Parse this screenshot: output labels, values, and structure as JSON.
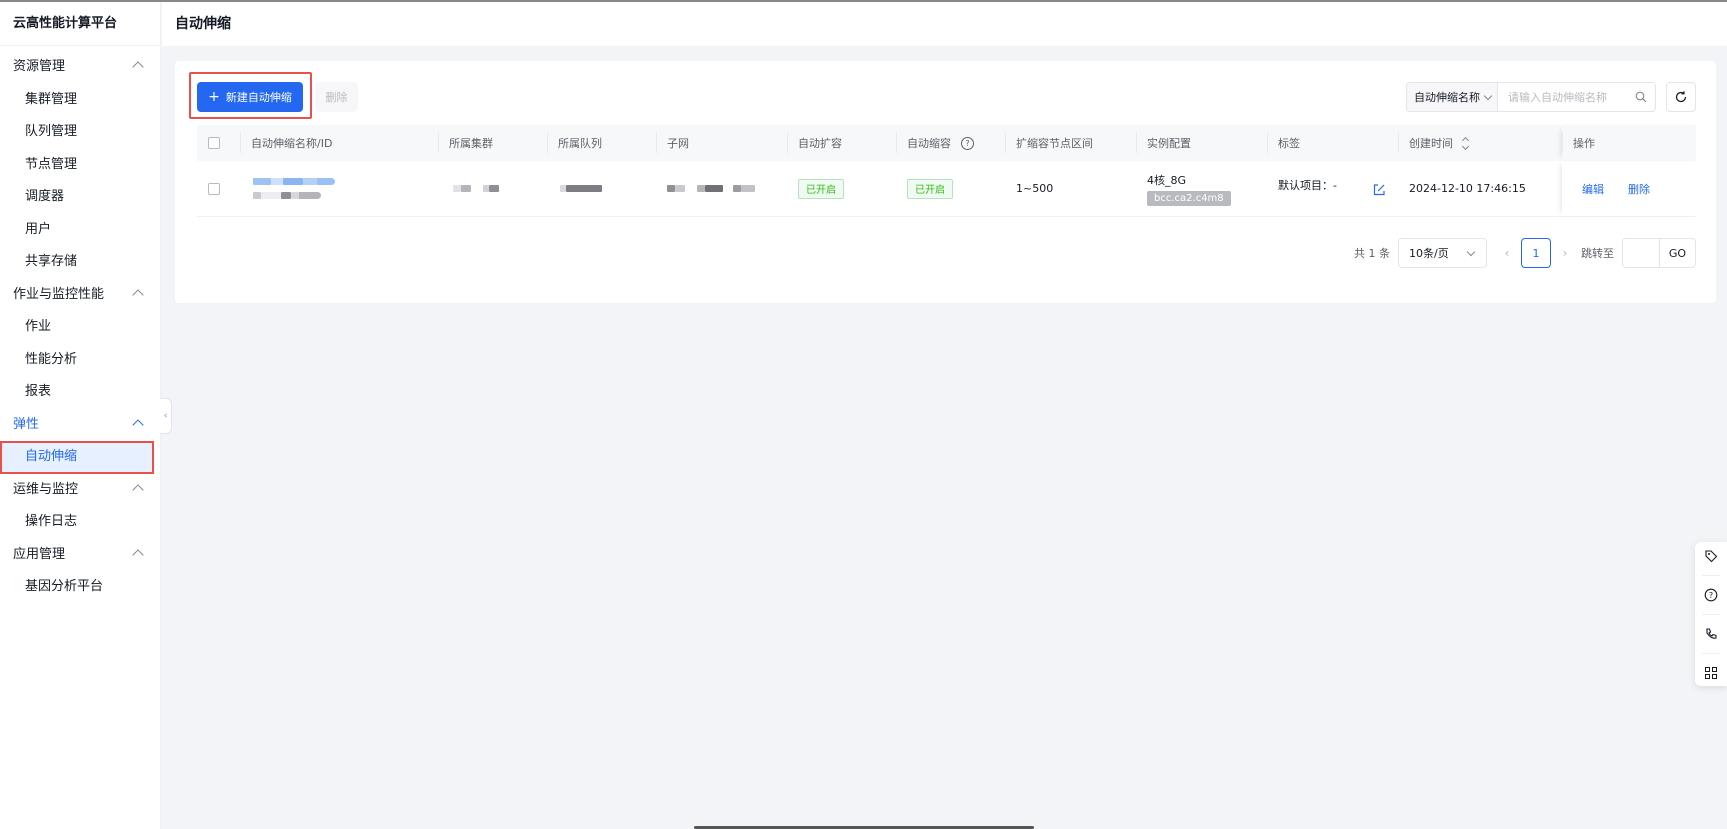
{
  "sidebar": {
    "brand": "云高性能计算平台",
    "groups": [
      {
        "label": "资源管理",
        "items": [
          "集群管理",
          "队列管理",
          "节点管理",
          "调度器",
          "用户",
          "共享存储"
        ]
      },
      {
        "label": "作业与监控性能",
        "items": [
          "作业",
          "性能分析",
          "报表"
        ]
      },
      {
        "label": "弹性",
        "items": [
          "自动伸缩"
        ],
        "active": true
      },
      {
        "label": "运维与监控",
        "items": [
          "操作日志"
        ]
      },
      {
        "label": "应用管理",
        "items": [
          "基因分析平台"
        ]
      }
    ]
  },
  "header": {
    "title": "自动伸缩"
  },
  "toolbar": {
    "create_label": "新建自动伸缩",
    "delete_label": "删除",
    "search_field": "自动伸缩名称",
    "search_placeholder": "请输入自动伸缩名称"
  },
  "table": {
    "columns": [
      "自动伸缩名称/ID",
      "所属集群",
      "所属队列",
      "子网",
      "自动扩容",
      "自动缩容",
      "扩缩容节点区间",
      "实例配置",
      "标签",
      "创建时间",
      "操作"
    ],
    "rows": [
      {
        "auto_scale_up": "已开启",
        "auto_scale_down": "已开启",
        "node_range": "1~500",
        "spec": "4核_8G",
        "spec_type": "bcc.ca2.c4m8",
        "tags": "默认项目：-",
        "created_at": "2024-12-10 17:46:15",
        "actions": [
          "编辑",
          "删除"
        ]
      }
    ]
  },
  "pagination": {
    "total": "共 1 条",
    "page_size": "10条/页",
    "current_page": "1",
    "jump_label": "跳转至",
    "go_label": "GO"
  },
  "colors": {
    "primary": "#2468f2",
    "highlight_border": "#e8504a",
    "success": "#30bf13"
  }
}
